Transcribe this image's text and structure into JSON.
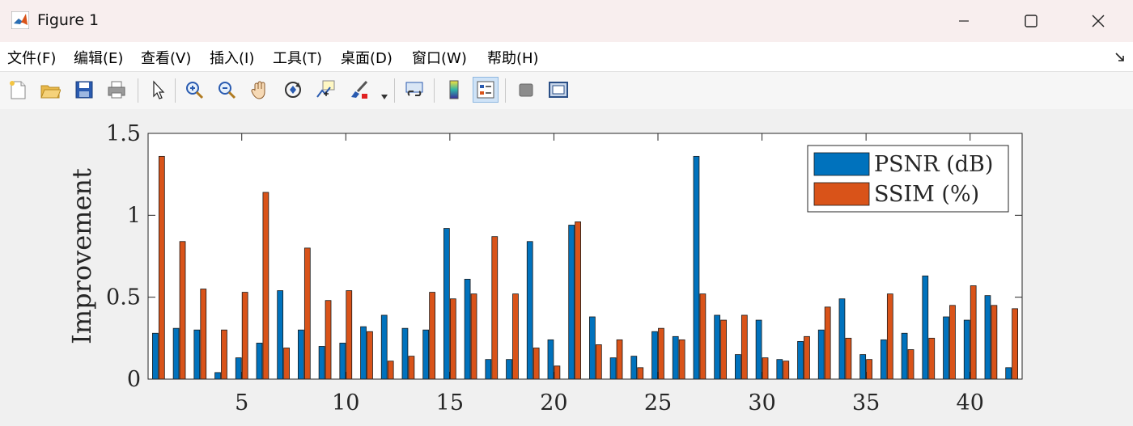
{
  "window": {
    "title": "Figure 1"
  },
  "menu": [
    "文件(F)",
    "编辑(E)",
    "查看(V)",
    "插入(I)",
    "工具(T)",
    "桌面(D)",
    "窗口(W)",
    "帮助(H)"
  ],
  "toolbar": {
    "icons": [
      "new-figure-icon",
      "open-file-icon",
      "save-icon",
      "print-icon",
      "pointer-icon",
      "zoom-in-icon",
      "zoom-out-icon",
      "pan-hand-icon",
      "rotate-3d-icon",
      "data-cursor-icon",
      "brush-icon",
      "brush-dropdown-icon",
      "link-plot-icon",
      "colorbar-icon",
      "legend-icon",
      "hide-plot-tools-icon",
      "show-plot-tools-icon"
    ]
  },
  "colors": {
    "psnr": "#0072BD",
    "ssim": "#D95319"
  },
  "chart_data": {
    "type": "bar",
    "ylabel": "Improvement",
    "xlabel": "",
    "ylim": [
      0,
      1.5
    ],
    "xlim": [
      0.5,
      42.5
    ],
    "yticks": [
      0,
      0.5,
      1,
      1.5
    ],
    "ytick_labels": [
      "0",
      "0.5",
      "1",
      "1.5"
    ],
    "xticks": [
      5,
      10,
      15,
      20,
      25,
      30,
      35,
      40
    ],
    "xtick_labels": [
      "5",
      "10",
      "15",
      "20",
      "25",
      "30",
      "35",
      "40"
    ],
    "legend_position": "top-right",
    "categories": [
      1,
      2,
      3,
      4,
      5,
      6,
      7,
      8,
      9,
      10,
      11,
      12,
      13,
      14,
      15,
      16,
      17,
      18,
      19,
      20,
      21,
      22,
      23,
      24,
      25,
      26,
      27,
      28,
      29,
      30,
      31,
      32,
      33,
      34,
      35,
      36,
      37,
      38,
      39,
      40,
      41,
      42
    ],
    "series": [
      {
        "name": "PSNR (dB)",
        "color": "#0072BD",
        "values": [
          0.28,
          0.31,
          0.3,
          0.04,
          0.13,
          0.22,
          0.54,
          0.3,
          0.2,
          0.22,
          0.32,
          0.39,
          0.31,
          0.3,
          0.92,
          0.61,
          0.12,
          0.12,
          0.84,
          0.24,
          0.94,
          0.38,
          0.13,
          0.14,
          0.29,
          0.26,
          1.36,
          0.39,
          0.15,
          0.36,
          0.12,
          0.23,
          0.3,
          0.49,
          0.15,
          0.24,
          0.28,
          0.63,
          0.38,
          0.36,
          0.51,
          0.07
        ]
      },
      {
        "name": "SSIM (%)",
        "color": "#D95319",
        "values": [
          1.36,
          0.84,
          0.55,
          0.3,
          0.53,
          1.14,
          0.19,
          0.8,
          0.48,
          0.54,
          0.29,
          0.11,
          0.14,
          0.53,
          0.49,
          0.52,
          0.87,
          0.52,
          0.19,
          0.08,
          0.96,
          0.21,
          0.24,
          0.07,
          0.31,
          0.24,
          0.52,
          0.36,
          0.39,
          0.13,
          0.11,
          0.26,
          0.44,
          0.25,
          0.12,
          0.52,
          0.18,
          0.25,
          0.45,
          0.57,
          0.45,
          0.43
        ]
      }
    ]
  }
}
